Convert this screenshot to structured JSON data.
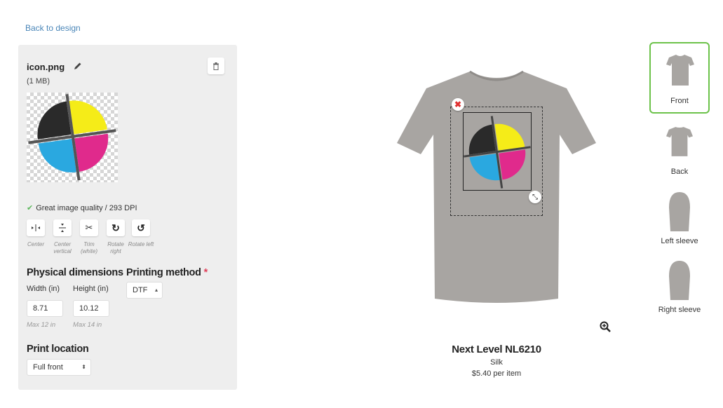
{
  "nav": {
    "back_label": "Back to design"
  },
  "file": {
    "name": "icon.png",
    "size": "(1 MB)"
  },
  "quality": {
    "text": "Great image quality / 293 DPI"
  },
  "tools": [
    {
      "label": "Center",
      "icon": "center-horizontal-icon"
    },
    {
      "label": "Center vertical",
      "icon": "center-vertical-icon"
    },
    {
      "label": "Trim (white)",
      "icon": "scissors-icon"
    },
    {
      "label": "Rotate right",
      "icon": "rotate-right-icon"
    },
    {
      "label": "Rotate left",
      "icon": "rotate-left-icon"
    }
  ],
  "dimensions": {
    "heading": "Physical dimensions",
    "width_label": "Width (in)",
    "height_label": "Height (in)",
    "width_value": "8.71",
    "height_value": "10.12",
    "width_max": "Max 12 in",
    "height_max": "Max 14 in"
  },
  "printing": {
    "heading": "Printing method",
    "required": "*",
    "value": "DTF"
  },
  "location": {
    "heading": "Print location",
    "value": "Full front"
  },
  "product": {
    "name": "Next Level NL6210",
    "color": "Silk",
    "price": "$5.40 per item"
  },
  "views": [
    {
      "label": "Front",
      "active": true
    },
    {
      "label": "Back",
      "active": false
    },
    {
      "label": "Left sleeve",
      "active": false
    },
    {
      "label": "Right sleeve",
      "active": false
    }
  ],
  "colors": {
    "accent_green": "#6cc24a",
    "link": "#4a86b8",
    "required": "#e0405a",
    "shirt": "#a8a5a2"
  }
}
